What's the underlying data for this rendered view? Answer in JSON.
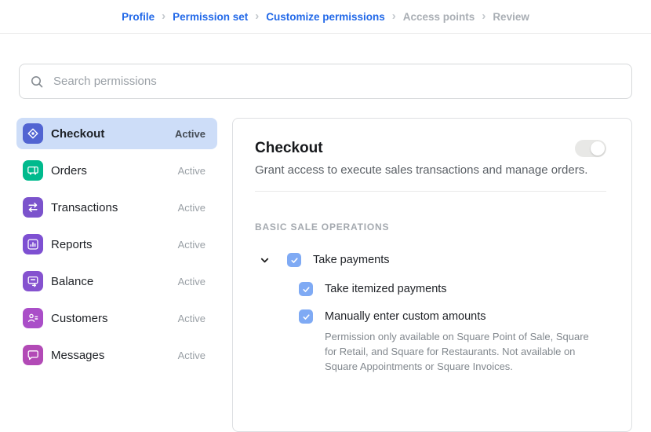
{
  "colors": {
    "link_blue": "#2168e8",
    "checkbox_blue": "#7faaf4",
    "selected_row": "#cdddf8",
    "toggle_track": "#e8e8e6"
  },
  "breadcrumb": {
    "separator": "›",
    "items": [
      {
        "label": "Profile",
        "state": "link"
      },
      {
        "label": "Permission set",
        "state": "link"
      },
      {
        "label": "Customize permissions",
        "state": "link"
      },
      {
        "label": "Access points",
        "state": "disabled"
      },
      {
        "label": "Review",
        "state": "disabled"
      }
    ]
  },
  "search": {
    "placeholder": "Search permissions"
  },
  "sidebar": {
    "items": [
      {
        "label": "Checkout",
        "status": "Active",
        "icon": "checkout-icon",
        "color": "#5164d2",
        "selected": true
      },
      {
        "label": "Orders",
        "status": "Active",
        "icon": "orders-icon",
        "color": "#00ba8d",
        "selected": false
      },
      {
        "label": "Transactions",
        "status": "Active",
        "icon": "transactions-icon",
        "color": "#7b53cc",
        "selected": false
      },
      {
        "label": "Reports",
        "status": "Active",
        "icon": "reports-icon",
        "color": "#7e50d2",
        "selected": false
      },
      {
        "label": "Balance",
        "status": "Active",
        "icon": "balance-icon",
        "color": "#8552cf",
        "selected": false
      },
      {
        "label": "Customers",
        "status": "Active",
        "icon": "customers-icon",
        "color": "#aa4ec8",
        "selected": false
      },
      {
        "label": "Messages",
        "status": "Active",
        "icon": "messages-icon",
        "color": "#b24ab6",
        "selected": false
      }
    ]
  },
  "panel": {
    "title": "Checkout",
    "toggle_state": "on",
    "description": "Grant access to execute sales transactions and manage orders.",
    "section_label": "BASIC SALE OPERATIONS",
    "permissions": [
      {
        "label": "Take payments",
        "checked": true,
        "expandable": true
      },
      {
        "label": "Take itemized payments",
        "checked": true
      },
      {
        "label": "Manually enter custom amounts",
        "checked": true,
        "note": "Permission only available on Square Point of Sale, Square for Retail, and Square for Restaurants. Not available on Square Appointments or Square Invoices."
      }
    ]
  }
}
